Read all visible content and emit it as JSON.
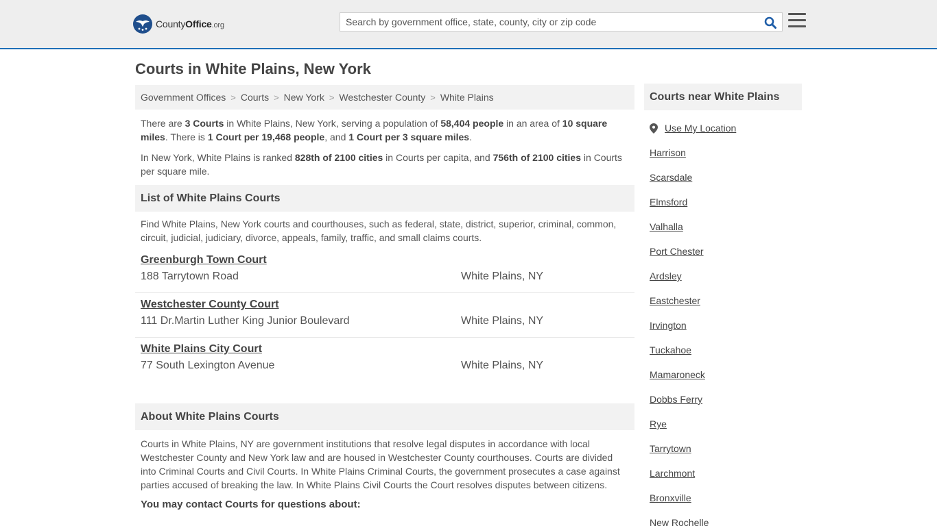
{
  "header": {
    "logo": {
      "part1": "County",
      "part2": "Office",
      "part3": ".org"
    },
    "search_placeholder": "Search by government office, state, county, city or zip code"
  },
  "page_title": "Courts in White Plains, New York",
  "breadcrumb": [
    {
      "label": "Government Offices"
    },
    {
      "label": "Courts"
    },
    {
      "label": "New York"
    },
    {
      "label": "Westchester County"
    },
    {
      "label": "White Plains"
    }
  ],
  "intro": {
    "p1": {
      "t1": "There are ",
      "b1": "3 Courts",
      "t2": " in White Plains, New York, serving a population of ",
      "b2": "58,404 people",
      "t3": " in an area of ",
      "b3": "10 square miles",
      "t4": ". There is ",
      "b4": "1 Court per 19,468 people",
      "t5": ", and ",
      "b5": "1 Court per 3 square miles",
      "t6": "."
    },
    "p2": {
      "t1": "In New York, White Plains is ranked ",
      "b1": "828th of 2100 cities",
      "t2": " in Courts per capita, and ",
      "b2": "756th of 2100 cities",
      "t3": " in Courts per square mile."
    }
  },
  "list_section": {
    "title": "List of White Plains Courts",
    "description": "Find White Plains, New York courts and courthouses, such as federal, state, district, superior, criminal, common, circuit, judicial, judiciary, divorce, appeals, family, traffic, and small claims courts."
  },
  "courts": [
    {
      "name": "Greenburgh Town Court",
      "address": "188 Tarrytown Road",
      "city": "White Plains, NY"
    },
    {
      "name": "Westchester County Court",
      "address": "111 Dr.Martin Luther King Junior Boulevard",
      "city": "White Plains, NY"
    },
    {
      "name": "White Plains City Court",
      "address": "77 South Lexington Avenue",
      "city": "White Plains, NY"
    }
  ],
  "about_section": {
    "title": "About White Plains Courts",
    "text": "Courts in White Plains, NY are government institutions that resolve legal disputes in accordance with local Westchester County and New York law and are housed in Westchester County courthouses. Courts are divided into Criminal Courts and Civil Courts. In White Plains Criminal Courts, the government prosecutes a case against parties accused of breaking the law. In White Plains Civil Courts the Court resolves disputes between citizens.",
    "contact_heading": "You may contact Courts for questions about:"
  },
  "sidebar": {
    "title": "Courts near White Plains",
    "use_location": "Use My Location",
    "cities": [
      "Harrison",
      "Scarsdale",
      "Elmsford",
      "Valhalla",
      "Port Chester",
      "Ardsley",
      "Eastchester",
      "Irvington",
      "Tuckahoe",
      "Mamaroneck",
      "Dobbs Ferry",
      "Rye",
      "Tarrytown",
      "Larchmont",
      "Bronxville",
      "New Rochelle"
    ]
  },
  "icons": {
    "search": "search-icon",
    "menu": "hamburger-menu-icon",
    "location": "map-pin-icon",
    "logo": "eagle-stars-logo-icon"
  },
  "colors": {
    "header_border": "#1e6fb7",
    "search_icon": "#1f5ea8",
    "logo_badge": "#1f4e8c"
  }
}
